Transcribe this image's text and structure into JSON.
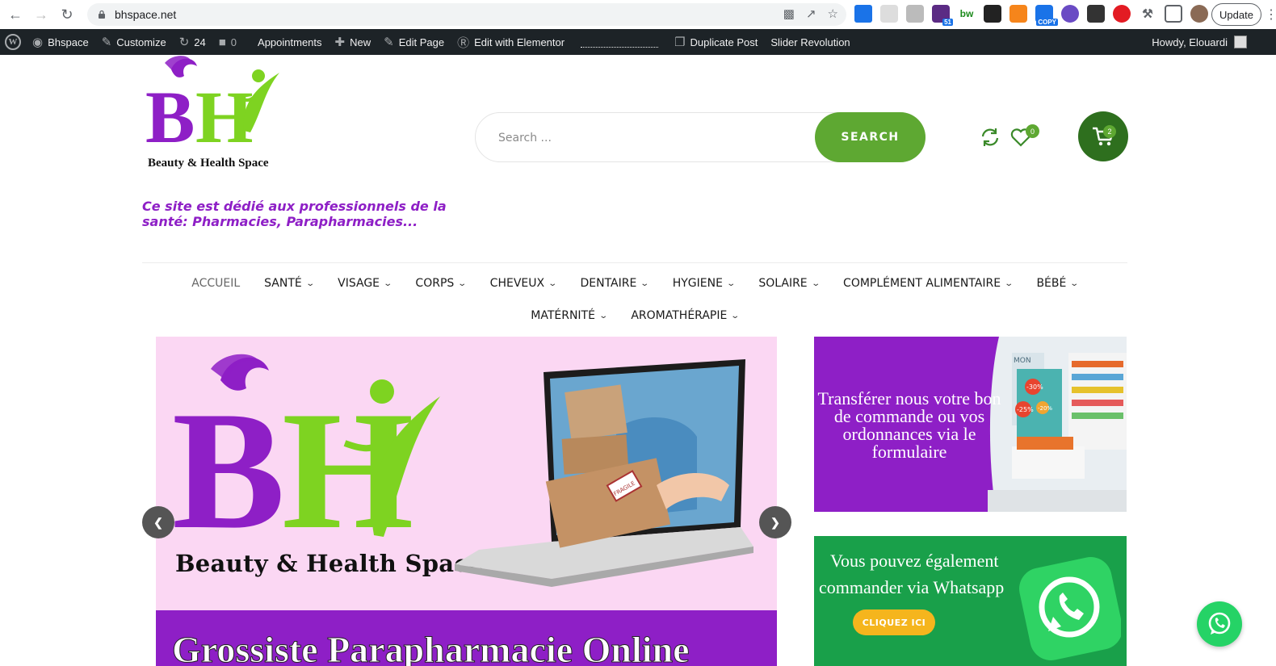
{
  "browser": {
    "url": "bhspace.net",
    "update_label": "Update",
    "ext_badge_51": "51",
    "ext_badge_copy": "COPY",
    "ext_bw": "bw"
  },
  "adminbar": {
    "site": "Bhspace",
    "customize": "Customize",
    "updates": "24",
    "comments": "0",
    "appointments": "Appointments",
    "new": "New",
    "edit_page": "Edit Page",
    "edit_elementor": "Edit with Elementor",
    "duplicate": "Duplicate Post",
    "slider_rev": "Slider Revolution",
    "howdy": "Howdy, Elouardi"
  },
  "header": {
    "logo_caption": "Beauty & Health Space",
    "tagline": "Ce site est dédié aux professionnels de la santé: Pharmacies, Parapharmacies...",
    "search_placeholder": "Search ...",
    "search_button": "SEARCH",
    "wishlist_count": "0",
    "cart_count": "2"
  },
  "menu": {
    "items": [
      {
        "label": "ACCUEIL"
      },
      {
        "label": "SANTÉ"
      },
      {
        "label": "VISAGE"
      },
      {
        "label": "CORPS"
      },
      {
        "label": "CHEVEUX"
      },
      {
        "label": "DENTAIRE"
      },
      {
        "label": "HYGIENE"
      },
      {
        "label": "SOLAIRE"
      },
      {
        "label": "COMPLÉMENT ALIMENTAIRE"
      },
      {
        "label": "BÉBÉ"
      },
      {
        "label": "MATÉRNITÉ"
      },
      {
        "label": "AROMATHÉRAPIE"
      }
    ]
  },
  "slider": {
    "brand": "Beauty & Health Space",
    "banner": "Grossiste Parapharmacie Online",
    "parcel_stamp": "FRAGILE"
  },
  "promo1": {
    "text": "Transférer nous votre bon de commande ou vos ordonnances via le formulaire",
    "photo_sign": "MON",
    "discounts": [
      "-30%",
      "-25%",
      "-20%"
    ]
  },
  "promo2": {
    "line1": "Vous pouvez également",
    "line2": "commander via Whatsapp",
    "button": "CLIQUEZ ICI"
  },
  "colors": {
    "brand_purple": "#8e1fc6",
    "brand_green": "#5ea832",
    "cart_green": "#2e6f1e",
    "whatsapp": "#25d366"
  }
}
